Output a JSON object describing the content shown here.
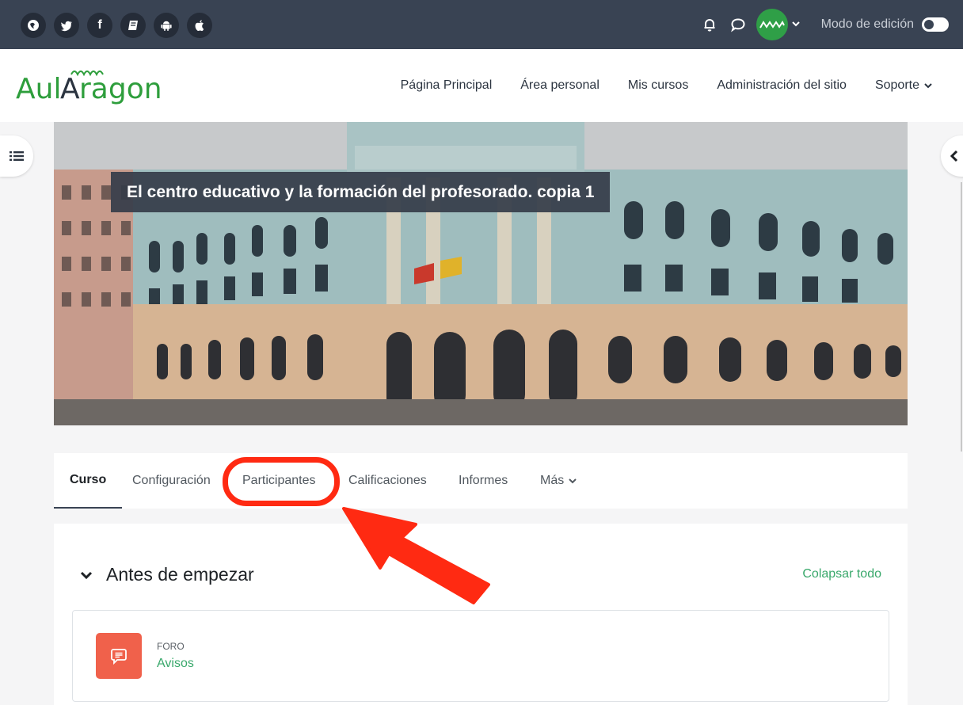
{
  "topbar": {
    "social_icons": [
      "globe-icon",
      "twitter-icon",
      "facebook-icon",
      "book-icon",
      "android-icon",
      "apple-icon"
    ],
    "edit_mode_label": "Modo de edición"
  },
  "navbar": {
    "logo_text": "AulAragon",
    "links": [
      "Página Principal",
      "Área personal",
      "Mis cursos",
      "Administración del sitio",
      "Soporte"
    ]
  },
  "course": {
    "title": "El centro educativo y la formación del profesorado. copia 1"
  },
  "tabs": [
    "Curso",
    "Configuración",
    "Participantes",
    "Calificaciones",
    "Informes",
    "Más"
  ],
  "section": {
    "title": "Antes de empezar",
    "collapse_all": "Colapsar todo"
  },
  "activity": {
    "type": "FORO",
    "name": "Avisos"
  },
  "colors": {
    "topbar": "#394353",
    "accent_green": "#39a86b",
    "forum_icon": "#f0614b",
    "highlight_red": "#ff2a12"
  }
}
